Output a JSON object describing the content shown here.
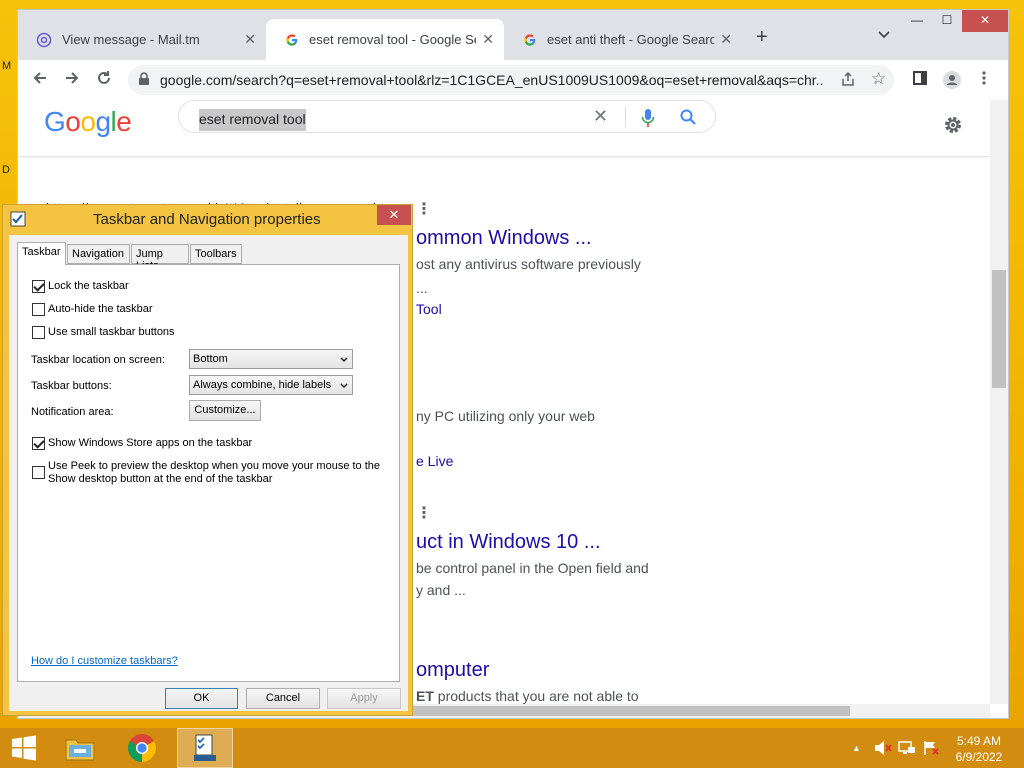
{
  "desktop": {
    "edge_letters": [
      "M",
      "D"
    ]
  },
  "browser": {
    "tabs": [
      {
        "label": "View message - Mail.tm",
        "icon": "at-sign-icon"
      },
      {
        "label": "eset removal tool - Google Search",
        "icon": "google-g-icon"
      },
      {
        "label": "eset anti theft - Google Search",
        "icon": "google-g-icon"
      }
    ],
    "tab_close": "✕",
    "new_tab": "+",
    "url": "google.com/search?q=eset+removal+tool&rlz=1C1GCEA_enUS1009US1009&oq=eset+removal&aqs=chr...",
    "window_controls": {
      "minimize": "—",
      "maximize": "☐",
      "close": "✕"
    }
  },
  "google": {
    "logo": [
      "G",
      "o",
      "o",
      "g",
      "l",
      "e"
    ],
    "logo_colors": [
      "#4285f4",
      "#ea4335",
      "#fbbc05",
      "#4285f4",
      "#34a853",
      "#ea4335"
    ],
    "query": "eset removal tool",
    "clear": "✕"
  },
  "results": {
    "cite": "https://support.eset.com › kb146-uninstallers-removal-t...",
    "title1": "ommon Windows ...",
    "snip1a": "ost any antivirus software previously",
    "snip1b": "...",
    "link1": "Tool",
    "snip2": "ny PC utilizing only your web",
    "link2": "e Live",
    "title2": "uct in Windows 10 ...",
    "snip3a": "be control panel in the Open field and",
    "snip3b": "y and ...",
    "title3": "omputer",
    "snip4_bold": "ET",
    "snip4": " products that you are not able to",
    "dots": "⋮"
  },
  "dialog": {
    "title": "Taskbar and Navigation properties",
    "close": "✕",
    "tabs": [
      "Taskbar",
      "Navigation",
      "Jump Lists",
      "Toolbars"
    ],
    "checks": {
      "lock": {
        "label": "Lock the taskbar",
        "checked": true
      },
      "autohide": {
        "label": "Auto-hide the taskbar",
        "checked": false
      },
      "small": {
        "label": "Use small taskbar buttons",
        "checked": false
      },
      "store": {
        "label": "Show Windows Store apps on the taskbar",
        "checked": true
      },
      "peek": {
        "label": "Use Peek to preview the desktop when you move your mouse to the Show desktop button at the end of the taskbar",
        "checked": false
      }
    },
    "location_label": "Taskbar location on screen:",
    "location_value": "Bottom",
    "buttons_label": "Taskbar buttons:",
    "buttons_value": "Always combine, hide labels",
    "notif_label": "Notification area:",
    "customize": "Customize...",
    "help": "How do I customize taskbars?",
    "ok": "OK",
    "cancel": "Cancel",
    "apply": "Apply"
  },
  "taskbar": {
    "time": "5:49 AM",
    "date": "6/9/2022",
    "tray_up": "▲"
  },
  "colors": {
    "accent": "#f0b000",
    "link": "#1a0dab",
    "taskbar": "#d28d10"
  }
}
